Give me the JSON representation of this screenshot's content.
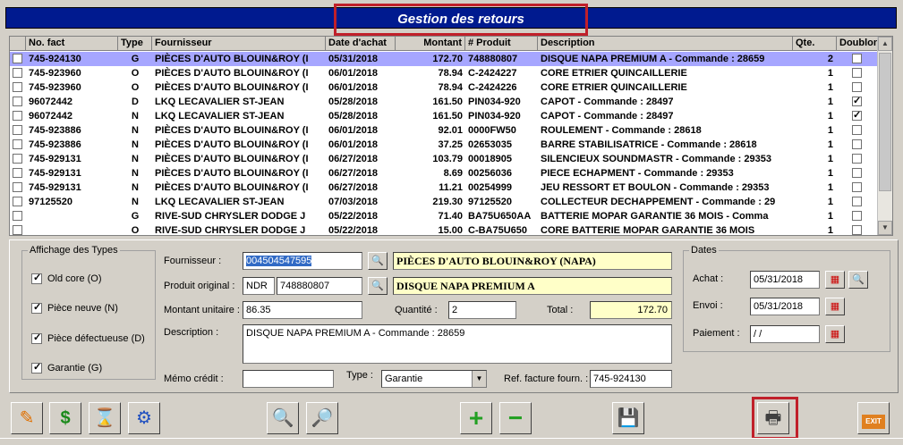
{
  "title": "Gestion des retours",
  "columns": {
    "c0": "",
    "c1": "No. fact",
    "c2": "Type",
    "c3": "Fournisseur",
    "c4": "Date d'achat",
    "c5": "Montant",
    "c6": "# Produit",
    "c7": "Description",
    "c8": "Qte.",
    "c9": "Doublon"
  },
  "rows": [
    {
      "fact": "745-924130",
      "type": "G",
      "fournisseur": "PIÈCES D'AUTO BLOUIN&ROY (I",
      "date": "05/31/2018",
      "montant": "172.70",
      "produit": "748880807",
      "description": "DISQUE NAPA PREMIUM A - Commande : 28659",
      "qte": "2",
      "doublon": false,
      "selected": true
    },
    {
      "fact": "745-923960",
      "type": "O",
      "fournisseur": "PIÈCES D'AUTO BLOUIN&ROY (I",
      "date": "06/01/2018",
      "montant": "78.94",
      "produit": "C-2424227",
      "description": "CORE ETRIER QUINCAILLERIE",
      "qte": "1",
      "doublon": false
    },
    {
      "fact": "745-923960",
      "type": "O",
      "fournisseur": "PIÈCES D'AUTO BLOUIN&ROY (I",
      "date": "06/01/2018",
      "montant": "78.94",
      "produit": "C-2424226",
      "description": "CORE ETRIER QUINCAILLERIE",
      "qte": "1",
      "doublon": false
    },
    {
      "fact": "96072442",
      "type": "D",
      "fournisseur": "LKQ LECAVALIER ST-JEAN",
      "date": "05/28/2018",
      "montant": "161.50",
      "produit": "PIN034-920",
      "description": "CAPOT - Commande : 28497",
      "qte": "1",
      "doublon": true
    },
    {
      "fact": "96072442",
      "type": "N",
      "fournisseur": "LKQ LECAVALIER ST-JEAN",
      "date": "05/28/2018",
      "montant": "161.50",
      "produit": "PIN034-920",
      "description": "CAPOT - Commande : 28497",
      "qte": "1",
      "doublon": true
    },
    {
      "fact": "745-923886",
      "type": "N",
      "fournisseur": "PIÈCES D'AUTO BLOUIN&ROY (I",
      "date": "06/01/2018",
      "montant": "92.01",
      "produit": "0000FW50",
      "description": "ROULEMENT - Commande : 28618",
      "qte": "1",
      "doublon": false
    },
    {
      "fact": "745-923886",
      "type": "N",
      "fournisseur": "PIÈCES D'AUTO BLOUIN&ROY (I",
      "date": "06/01/2018",
      "montant": "37.25",
      "produit": "02653035",
      "description": "BARRE STABILISATRICE - Commande : 28618",
      "qte": "1",
      "doublon": false
    },
    {
      "fact": "745-929131",
      "type": "N",
      "fournisseur": "PIÈCES D'AUTO BLOUIN&ROY (I",
      "date": "06/27/2018",
      "montant": "103.79",
      "produit": "00018905",
      "description": "SILENCIEUX SOUNDMASTR - Commande : 29353",
      "qte": "1",
      "doublon": false
    },
    {
      "fact": "745-929131",
      "type": "N",
      "fournisseur": "PIÈCES D'AUTO BLOUIN&ROY (I",
      "date": "06/27/2018",
      "montant": "8.69",
      "produit": "00256036",
      "description": "PIECE ECHAPMENT - Commande : 29353",
      "qte": "1",
      "doublon": false
    },
    {
      "fact": "745-929131",
      "type": "N",
      "fournisseur": "PIÈCES D'AUTO BLOUIN&ROY (I",
      "date": "06/27/2018",
      "montant": "11.21",
      "produit": "00254999",
      "description": "JEU RESSORT ET BOULON - Commande : 29353",
      "qte": "1",
      "doublon": false
    },
    {
      "fact": "97125520",
      "type": "N",
      "fournisseur": "LKQ LECAVALIER ST-JEAN",
      "date": "07/03/2018",
      "montant": "219.30",
      "produit": "97125520",
      "description": "COLLECTEUR DECHAPPEMENT - Commande : 29",
      "qte": "1",
      "doublon": false
    },
    {
      "fact": "",
      "type": "G",
      "fournisseur": "RIVE-SUD CHRYSLER DODGE J",
      "date": "05/22/2018",
      "montant": "71.40",
      "produit": "BA75U650AA",
      "description": "BATTERIE MOPAR GARANTIE 36 MOIS - Comma",
      "qte": "1",
      "doublon": false
    },
    {
      "fact": "",
      "type": "O",
      "fournisseur": "RIVE-SUD CHRYSLER DODGE J",
      "date": "05/22/2018",
      "montant": "15.00",
      "produit": "C-BA75U650",
      "description": "CORE BATTERIE MOPAR GARANTIE 36 MOIS",
      "qte": "1",
      "doublon": false
    }
  ],
  "types": {
    "legend": "Affichage des Types",
    "old_core": "Old core  (O)",
    "piece_neuve": "Pièce neuve  (N)",
    "piece_defectueuse": "Pièce défectueuse  (D)",
    "garantie": "Garantie  (G)"
  },
  "form": {
    "fournisseur_label": "Fournisseur :",
    "fournisseur_code": "004504547595",
    "fournisseur_name": "PIÈCES D'AUTO BLOUIN&ROY (NAPA)",
    "produit_label": "Produit original :",
    "produit_prefix": "NDR",
    "produit_code": "748880807",
    "produit_name": "DISQUE NAPA PREMIUM A",
    "montant_label": "Montant unitaire :",
    "montant_value": "86.35",
    "quantite_label": "Quantité :",
    "quantite_value": "2",
    "total_label": "Total :",
    "total_value": "172.70",
    "description_label": "Description :",
    "description_value": "DISQUE NAPA PREMIUM A - Commande : 28659",
    "memo_label": "Mémo crédit :",
    "memo_value": "",
    "type_label": "Type :",
    "type_value": "Garantie",
    "ref_label": "Ref. facture fourn. :",
    "ref_value": "745-924130"
  },
  "dates": {
    "legend": "Dates",
    "achat_label": "Achat :",
    "achat_value": "05/31/2018",
    "envoi_label": "Envoi :",
    "envoi_value": "05/31/2018",
    "paiement_label": "Paiement :",
    "paiement_value": " / /"
  },
  "exit_label": "EXIT"
}
